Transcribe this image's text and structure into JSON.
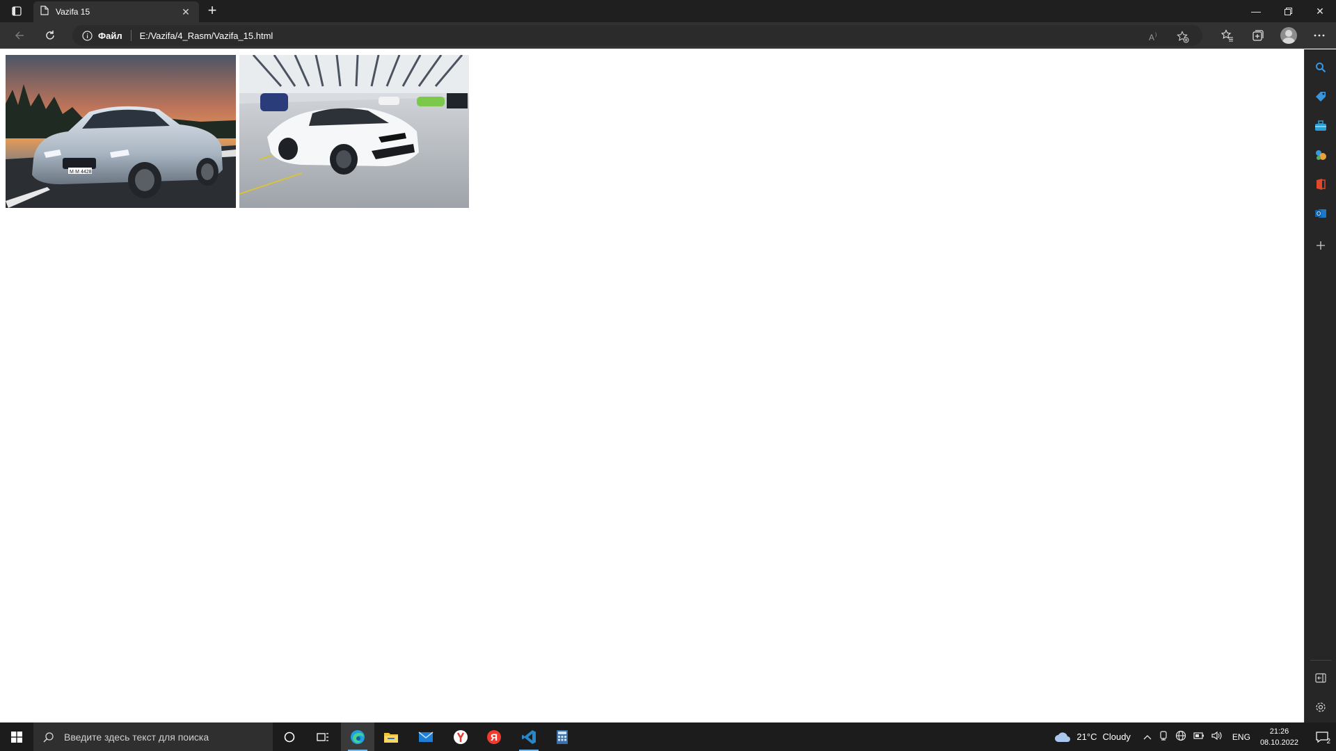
{
  "browser": {
    "tab": {
      "title": "Vazifa 15"
    },
    "address": {
      "protocol_label": "Файл",
      "url": "E:/Vazifa/4_Rasm/Vazifa_15.html"
    }
  },
  "page": {
    "images": [
      {
        "alt": "Silver BMW coupe at sunset",
        "subject": "bmw-car"
      },
      {
        "alt": "White Lamborghini in showroom",
        "subject": "lamborghini-car"
      }
    ]
  },
  "taskbar": {
    "search_placeholder": "Введите здесь текст для поиска",
    "weather": {
      "temp": "21°C",
      "condition": "Cloudy"
    },
    "language": "ENG",
    "time": "21:26",
    "date": "08.10.2022",
    "notification_count": "2"
  },
  "colors": {
    "titlebar": "#1f1f1f",
    "toolbar": "#323232",
    "taskbar": "#1c1c1c",
    "accent": "#76b9ed"
  }
}
